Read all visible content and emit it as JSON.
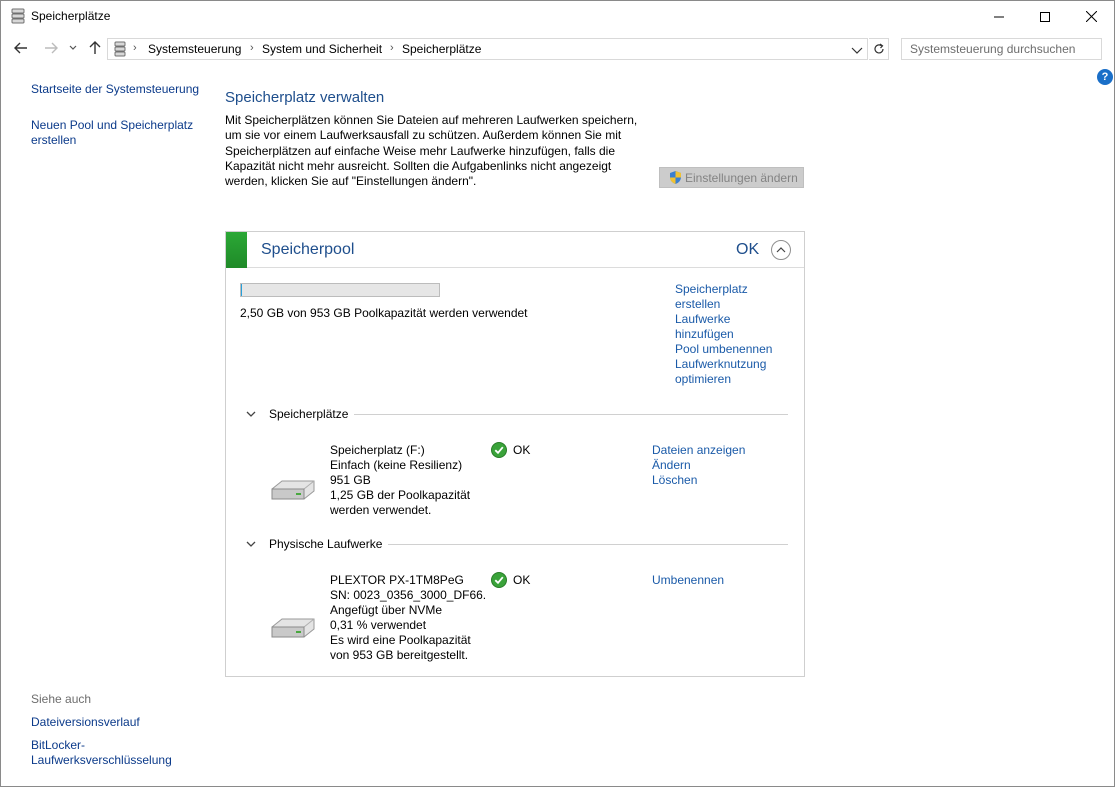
{
  "window": {
    "title": "Speicherplätze",
    "icon": "storage-spaces-icon"
  },
  "address": {
    "crumbs": [
      "Systemsteuerung",
      "System und Sicherheit",
      "Speicherplätze"
    ],
    "search_placeholder": "Systemsteuerung durchsuchen"
  },
  "sidebar": {
    "home_link": "Startseite der Systemsteuerung",
    "new_pool_link_line1": "Neuen Pool und Speicherplatz",
    "new_pool_link_line2": "erstellen",
    "see_also_label": "Siehe auch",
    "see_also_links": [
      "Dateiversionsverlauf",
      "BitLocker-",
      "Laufwerksverschlüsselung"
    ]
  },
  "main": {
    "heading": "Speicherplatz verwalten",
    "description_lines": [
      "Mit Speicherplätzen können Sie Dateien auf mehreren Laufwerken speichern,",
      "um sie vor einem Laufwerksausfall zu schützen. Außerdem können Sie mit",
      "Speicherplätzen auf einfache Weise mehr Laufwerke hinzufügen, falls die",
      "Kapazität nicht mehr ausreicht. Sollten die Aufgabenlinks nicht angezeigt",
      "werden, klicken Sie auf \"Einstellungen ändern\"."
    ],
    "settings_button": "Einstellungen ändern"
  },
  "pool": {
    "title": "Speicherpool",
    "status": "OK",
    "usage_fraction": 0.0026,
    "usage_text": "2,50 GB von 953 GB Poolkapazität werden verwendet",
    "links": [
      "Speicherplatz",
      "erstellen",
      "Laufwerke",
      "hinzufügen",
      "Pool umbenennen",
      "Laufwerknutzung",
      "optimieren"
    ],
    "spaces_section": "Speicherplätze",
    "space": {
      "lines": [
        "Speicherplatz (F:)",
        "Einfach (keine Resilienz)",
        "951 GB",
        "1,25 GB der Poolkapazität",
        "werden verwendet."
      ],
      "status": "OK",
      "links": [
        "Dateien anzeigen",
        "Ändern",
        "Löschen"
      ]
    },
    "drives_section": "Physische Laufwerke",
    "drive": {
      "lines": [
        "PLEXTOR PX-1TM8PeG",
        "SN: 0023_0356_3000_DF66.",
        "Angefügt über NVMe",
        "0,31 % verwendet",
        "Es wird eine Poolkapazität",
        "von 953 GB bereitgestellt."
      ],
      "status": "OK",
      "links": [
        "Umbenennen"
      ]
    }
  },
  "colors": {
    "link": "#1a5aa8",
    "heading": "#1e4e8c",
    "pool_stripe": "#2ba836",
    "help": "#1a6fc8"
  }
}
